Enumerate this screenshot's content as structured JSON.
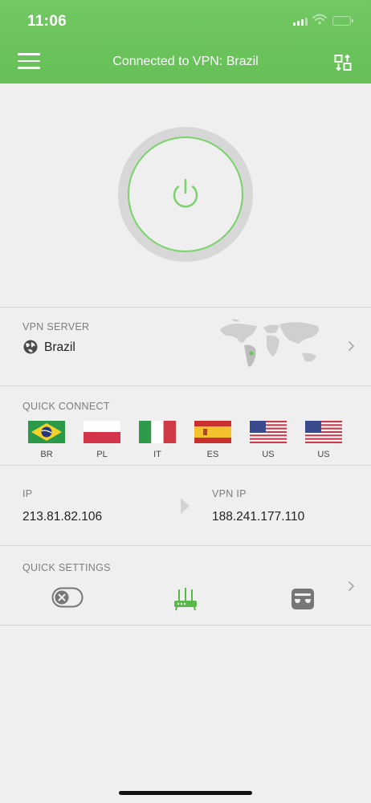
{
  "status_bar": {
    "time": "11:06"
  },
  "header": {
    "title": "Connected to VPN: Brazil"
  },
  "power": {
    "state": "connected"
  },
  "vpn_server": {
    "label": "VPN SERVER",
    "name": "Brazil"
  },
  "quick_connect": {
    "label": "QUICK CONNECT",
    "items": [
      {
        "code": "BR"
      },
      {
        "code": "PL"
      },
      {
        "code": "IT"
      },
      {
        "code": "ES"
      },
      {
        "code": "US"
      },
      {
        "code": "US"
      }
    ]
  },
  "ip_info": {
    "ip_label": "IP",
    "ip_value": "213.81.82.106",
    "vpn_ip_label": "VPN IP",
    "vpn_ip_value": "188.241.177.110"
  },
  "quick_settings": {
    "label": "QUICK SETTINGS",
    "icons": [
      "kill-switch-icon",
      "router-icon",
      "incognito-icon"
    ]
  },
  "colors": {
    "accent": "#6cc45c",
    "ring": "#79d36a",
    "background": "#efefef"
  }
}
